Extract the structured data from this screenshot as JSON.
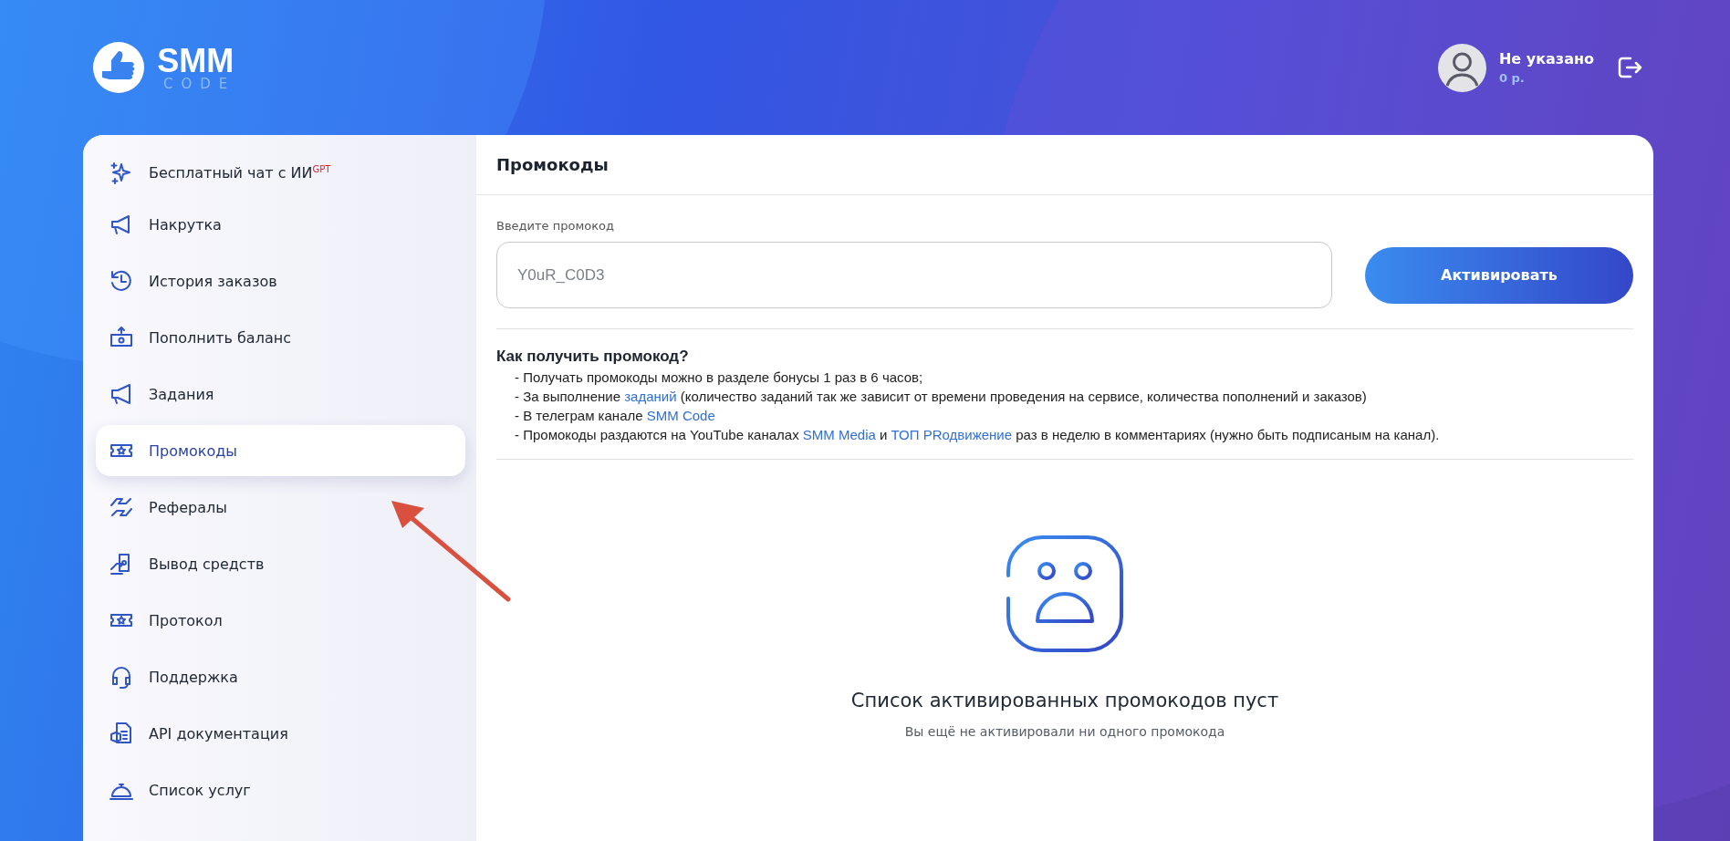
{
  "header": {
    "logo": {
      "title": "SMM",
      "subtitle": "CODE"
    },
    "user": {
      "name": "Не указано",
      "balance": "0 р."
    }
  },
  "sidebar": {
    "items": [
      {
        "label": "Бесплатный чат с ИИ$^{GPT}$",
        "selected": false
      },
      {
        "label": "Накрутка",
        "selected": false
      },
      {
        "label": "История заказов",
        "selected": false
      },
      {
        "label": "Пополнить баланс",
        "selected": false
      },
      {
        "label": "Задания",
        "selected": false
      },
      {
        "label": "Промокоды",
        "selected": true
      },
      {
        "label": "Рефералы",
        "selected": false
      },
      {
        "label": "Вывод средств",
        "selected": false
      },
      {
        "label": "Протокол",
        "selected": false
      },
      {
        "label": "Поддержка",
        "selected": false
      },
      {
        "label": "API документация",
        "selected": false
      },
      {
        "label": "Список услуг",
        "selected": false
      }
    ]
  },
  "content": {
    "title": "Промокоды",
    "promo_field": {
      "label": "Введите промокод",
      "placeholder": "Y0uR_C0D3"
    },
    "activate_button": "Активировать",
    "help": {
      "heading": "Как получить промокод?",
      "lines": [
        [
          {
            "text": "- Получать промокоды можно в разделе бонусы 1 раз в 6 часов;",
            "link": false
          }
        ],
        [
          {
            "text": "- За выполнение ",
            "link": false
          },
          {
            "text": "заданий",
            "link": true
          },
          {
            "text": " (количество заданий так же зависит от времени проведения на сервисе, количества пополнений и заказов)",
            "link": false
          }
        ],
        [
          {
            "text": "- В телеграм канале ",
            "link": false
          },
          {
            "text": "SMM Code",
            "link": true
          }
        ],
        [
          {
            "text": "- Промокоды раздаются на YouTube каналах ",
            "link": false
          },
          {
            "text": "SMM Media",
            "link": true
          },
          {
            "text": " и ",
            "link": false
          },
          {
            "text": "ТОП PRодвижение",
            "link": true
          },
          {
            "text": " раз в неделю в комментариях (нужно быть подписаным на канал).",
            "link": false
          }
        ]
      ]
    },
    "empty_state": {
      "title": "Список активированных промокодов пуст",
      "subtitle": "Вы ещё не активировали ни одного промокода"
    }
  }
}
